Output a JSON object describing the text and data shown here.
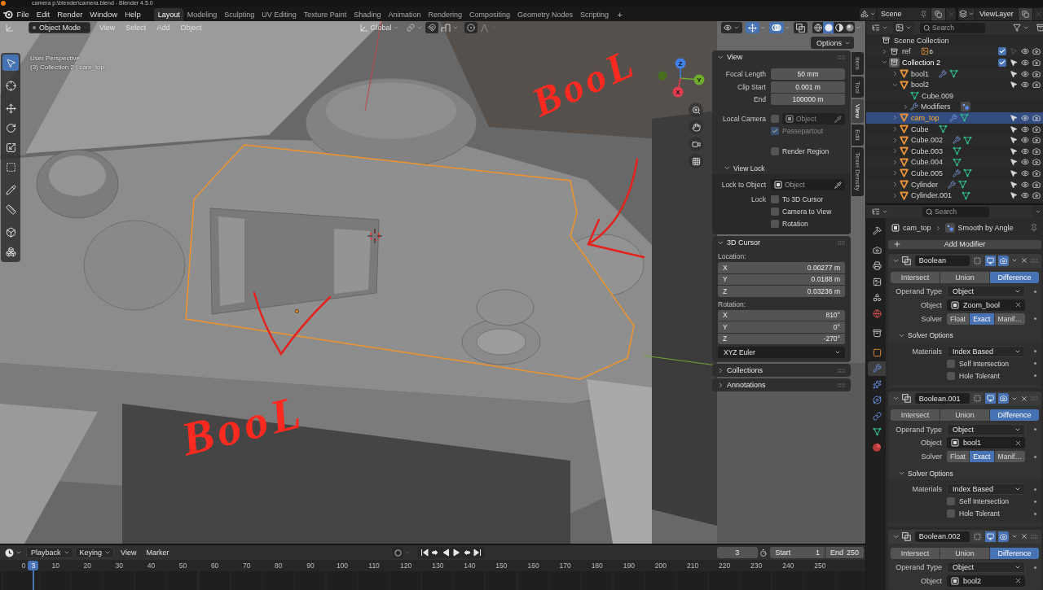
{
  "window": {
    "title": "camera p:\\blender\\camera.blend - Blender 4.5.0"
  },
  "menu": [
    "File",
    "Edit",
    "Render",
    "Window",
    "Help"
  ],
  "workspaces": [
    {
      "label": "Layout",
      "selected": true
    },
    {
      "label": "Modeling",
      "selected": false
    },
    {
      "label": "Sculpting",
      "selected": false
    },
    {
      "label": "UV Editing",
      "selected": false
    },
    {
      "label": "Texture Paint",
      "selected": false
    },
    {
      "label": "Shading",
      "selected": false
    },
    {
      "label": "Animation",
      "selected": false
    },
    {
      "label": "Rendering",
      "selected": false
    },
    {
      "label": "Compositing",
      "selected": false
    },
    {
      "label": "Geometry Nodes",
      "selected": false
    },
    {
      "label": "Scripting",
      "selected": false
    }
  ],
  "add_workspace": "+",
  "scene": "Scene",
  "view_layer": "ViewLayer",
  "viewport": {
    "mode": "Object Mode",
    "menus": [
      "View",
      "Select",
      "Add",
      "Object"
    ],
    "orientation": "Global",
    "toggles": [
      {
        "kind": "gizmos",
        "on": true
      },
      {
        "kind": "overlays",
        "on": true
      },
      {
        "kind": "xray",
        "on": false
      }
    ],
    "shading": [
      {
        "kind": "wireframe",
        "selected": false
      },
      {
        "kind": "solid",
        "selected": true
      },
      {
        "kind": "material",
        "selected": false
      },
      {
        "kind": "rendered",
        "selected": false
      }
    ],
    "options": "Options",
    "info": [
      "User Perspective",
      "(3) Collection 2 | cam_top"
    ],
    "tools": [
      {
        "kind": "select",
        "selected": true
      },
      {
        "kind": "cursor",
        "selected": false
      },
      {
        "kind": "move",
        "selected": false
      },
      {
        "kind": "rotate",
        "selected": false
      },
      {
        "kind": "scale",
        "selected": false
      },
      {
        "kind": "transform",
        "selected": false
      },
      {
        "kind": "annotate",
        "selected": false
      },
      {
        "kind": "measure",
        "selected": false
      },
      {
        "kind": "add_cube",
        "selected": false
      },
      {
        "kind": "add_object",
        "selected": false
      }
    ],
    "gizmo": [
      {
        "label": "Z",
        "color": "#3f7fe6"
      },
      {
        "label": "Y",
        "color": "#6ead2a"
      },
      {
        "label": "X",
        "color": "#e23d4e"
      }
    ],
    "annotations": [
      {
        "text": "BooL"
      },
      {
        "text": "BooL"
      }
    ]
  },
  "sidebar": {
    "tabs": [
      {
        "label": "Item",
        "selected": false
      },
      {
        "label": "Tool",
        "selected": false
      },
      {
        "label": "View",
        "selected": true
      },
      {
        "label": "Edit",
        "selected": false
      },
      {
        "label": "Texel Density",
        "selected": false
      }
    ],
    "sections": [
      {
        "kind": "view",
        "title": "View",
        "expanded": true,
        "fields": [
          {
            "label": "Focal Length",
            "value": "50 mm"
          },
          {
            "label": "Clip Start",
            "value": "0.001 m"
          },
          {
            "label": "End",
            "value": "100000 m"
          }
        ],
        "local_camera": {
          "label": "Local Camera",
          "checked": false,
          "placeholder": "Object"
        },
        "toggles": [
          {
            "label": "Passepartout",
            "checked": true,
            "disabled": true
          },
          {
            "label": "Render Region",
            "checked": false,
            "disabled": false
          }
        ],
        "view_lock": {
          "title": "View Lock",
          "expanded": true,
          "object_label": "Lock to Object",
          "object_placeholder": "Object",
          "lock_label": "Lock",
          "options": [
            {
              "label": "To 3D Cursor",
              "checked": false
            },
            {
              "label": "Camera to View",
              "checked": false
            },
            {
              "label": "Rotation",
              "checked": false
            }
          ]
        }
      },
      {
        "kind": "cursor",
        "title": "3D Cursor",
        "expanded": true,
        "location_label": "Location:",
        "location": [
          {
            "axis": "X",
            "value": "0.00277 m"
          },
          {
            "axis": "Y",
            "value": "0.0188 m"
          },
          {
            "axis": "Z",
            "value": "0.03236 m"
          }
        ],
        "rotation_label": "Rotation:",
        "rotation": [
          {
            "axis": "X",
            "value": "810°"
          },
          {
            "axis": "Y",
            "value": "0°"
          },
          {
            "axis": "Z",
            "value": "-270°"
          }
        ],
        "rotation_mode": "XYZ Euler"
      },
      {
        "title": "Collections",
        "expanded": false
      },
      {
        "title": "Annotations",
        "expanded": false
      }
    ]
  },
  "outliner": {
    "search_placeholder": "Search",
    "root": {
      "label": "Scene Collection",
      "children": [
        {
          "label": "ref",
          "kind": "collection",
          "expanded": false,
          "selected": false,
          "active": false,
          "included": true,
          "selectable": false,
          "badges": [
            {
              "kind": "image",
              "count": "6"
            }
          ]
        },
        {
          "label": "Collection 2",
          "kind": "collection",
          "expanded": true,
          "selected": false,
          "active": true,
          "included": true,
          "selectable": true,
          "children": [
            {
              "label": "bool1",
              "kind": "object",
              "expanded": false,
              "selected": false,
              "selectable": true,
              "badges": [
                {
                  "kind": "modifier"
                },
                {
                  "kind": "mesh"
                }
              ]
            },
            {
              "label": "bool2",
              "kind": "object",
              "expanded": true,
              "selected": false,
              "selectable": true,
              "children": [
                {
                  "label": "Cube.009",
                  "kind": "mesh",
                  "selected": false
                },
                {
                  "label": "Modifiers",
                  "kind": "modifiers",
                  "expanded": false,
                  "selected": false,
                  "badges": [
                    {
                      "kind": "smooth"
                    }
                  ]
                }
              ]
            },
            {
              "label": "cam_top",
              "kind": "object",
              "expanded": false,
              "selected": true,
              "selectable": true,
              "badges": [
                {
                  "kind": "modifier"
                },
                {
                  "kind": "mesh"
                }
              ]
            },
            {
              "label": "Cube",
              "kind": "object",
              "expanded": false,
              "selected": false,
              "selectable": true,
              "badges": [
                {
                  "kind": "mesh"
                }
              ]
            },
            {
              "label": "Cube.002",
              "kind": "object",
              "expanded": false,
              "selected": false,
              "selectable": true,
              "badges": [
                {
                  "kind": "modifier"
                },
                {
                  "kind": "mesh"
                }
              ]
            },
            {
              "label": "Cube.003",
              "kind": "object",
              "expanded": false,
              "selected": false,
              "selectable": true,
              "badges": [
                {
                  "kind": "mesh"
                }
              ]
            },
            {
              "label": "Cube.004",
              "kind": "object",
              "expanded": false,
              "selected": false,
              "selectable": true,
              "badges": [
                {
                  "kind": "mesh"
                }
              ]
            },
            {
              "label": "Cube.005",
              "kind": "object",
              "expanded": false,
              "selected": false,
              "selectable": true,
              "badges": [
                {
                  "kind": "modifier"
                },
                {
                  "kind": "mesh"
                }
              ]
            },
            {
              "label": "Cylinder",
              "kind": "object",
              "expanded": false,
              "selected": false,
              "selectable": true,
              "badges": [
                {
                  "kind": "modifier"
                },
                {
                  "kind": "mesh"
                }
              ]
            },
            {
              "label": "Cylinder.001",
              "kind": "object",
              "expanded": false,
              "selected": false,
              "selectable": true,
              "badges": [
                {
                  "kind": "mesh"
                }
              ]
            }
          ]
        }
      ]
    }
  },
  "properties": {
    "search_placeholder": "Search",
    "tabs": [
      {
        "kind": "tool",
        "selected": false
      },
      {
        "kind": "render",
        "selected": false
      },
      {
        "kind": "output",
        "selected": false
      },
      {
        "kind": "view_layer",
        "selected": false
      },
      {
        "kind": "scene",
        "selected": false
      },
      {
        "kind": "world",
        "selected": false
      },
      {
        "kind": "collection",
        "selected": false
      },
      {
        "kind": "object",
        "selected": false
      },
      {
        "kind": "modifiers",
        "selected": true
      },
      {
        "kind": "particles",
        "selected": false
      },
      {
        "kind": "physics",
        "selected": false
      },
      {
        "kind": "constraints",
        "selected": false
      },
      {
        "kind": "data",
        "selected": false
      },
      {
        "kind": "material",
        "selected": false
      }
    ],
    "breadcrumb": {
      "object": "cam_top",
      "modifier": "Smooth by Angle"
    },
    "add_modifier": "Add Modifier",
    "modifiers": [
      {
        "name": "Boolean",
        "expanded": true,
        "edit_mode": false,
        "viewport": true,
        "render": true,
        "operations": [
          {
            "label": "Intersect",
            "selected": false
          },
          {
            "label": "Union",
            "selected": false
          },
          {
            "label": "Difference",
            "selected": true
          }
        ],
        "operand_type": {
          "label": "Operand Type",
          "value": "Object"
        },
        "object": {
          "label": "Object",
          "value": "Zoom_bool"
        },
        "solver": {
          "label": "Solver",
          "options": [
            {
              "label": "Float",
              "selected": false
            },
            {
              "label": "Exact",
              "selected": true
            },
            {
              "label": "Manif…",
              "selected": false
            }
          ]
        },
        "solver_options": {
          "title": "Solver Options",
          "expanded": true,
          "materials": {
            "label": "Materials",
            "value": "Index Based"
          },
          "checks": [
            {
              "label": "Self Intersection",
              "checked": false
            },
            {
              "label": "Hole Tolerant",
              "checked": false
            }
          ]
        }
      },
      {
        "name": "Boolean.001",
        "expanded": true,
        "edit_mode": false,
        "viewport": true,
        "render": true,
        "operations": [
          {
            "label": "Intersect",
            "selected": false
          },
          {
            "label": "Union",
            "selected": false
          },
          {
            "label": "Difference",
            "selected": true
          }
        ],
        "operand_type": {
          "label": "Operand Type",
          "value": "Object"
        },
        "object": {
          "label": "Object",
          "value": "bool1"
        },
        "solver": {
          "label": "Solver",
          "options": [
            {
              "label": "Float",
              "selected": false
            },
            {
              "label": "Exact",
              "selected": true
            },
            {
              "label": "Manif…",
              "selected": false
            }
          ]
        },
        "solver_options": {
          "title": "Solver Options",
          "expanded": true,
          "materials": {
            "label": "Materials",
            "value": "Index Based"
          },
          "checks": [
            {
              "label": "Self Intersection",
              "checked": false
            },
            {
              "label": "Hole Tolerant",
              "checked": false
            }
          ]
        }
      },
      {
        "name": "Boolean.002",
        "expanded": true,
        "edit_mode": false,
        "viewport": true,
        "render": true,
        "operations": [
          {
            "label": "Intersect",
            "selected": false
          },
          {
            "label": "Union",
            "selected": false
          },
          {
            "label": "Difference",
            "selected": true
          }
        ],
        "operand_type": {
          "label": "Operand Type",
          "value": "Object"
        },
        "object": {
          "label": "Object",
          "value": "bool2"
        }
      }
    ]
  },
  "timeline": {
    "menus": [
      {
        "label": "Playback",
        "kind": "dropdown"
      },
      {
        "label": "Keying",
        "kind": "dropdown"
      },
      {
        "label": "View",
        "kind": "menu"
      },
      {
        "label": "Marker",
        "kind": "menu"
      }
    ],
    "current_frame": "3",
    "start": {
      "label": "Start",
      "value": "1"
    },
    "end": {
      "label": "End",
      "value": "250"
    },
    "ruler": [
      "0",
      "10",
      "20",
      "30",
      "40",
      "50",
      "60",
      "70",
      "80",
      "90",
      "100",
      "110",
      "120",
      "130",
      "140",
      "150",
      "160",
      "170",
      "180",
      "190",
      "200",
      "210",
      "220",
      "230",
      "240",
      "250"
    ],
    "playhead": "3"
  }
}
